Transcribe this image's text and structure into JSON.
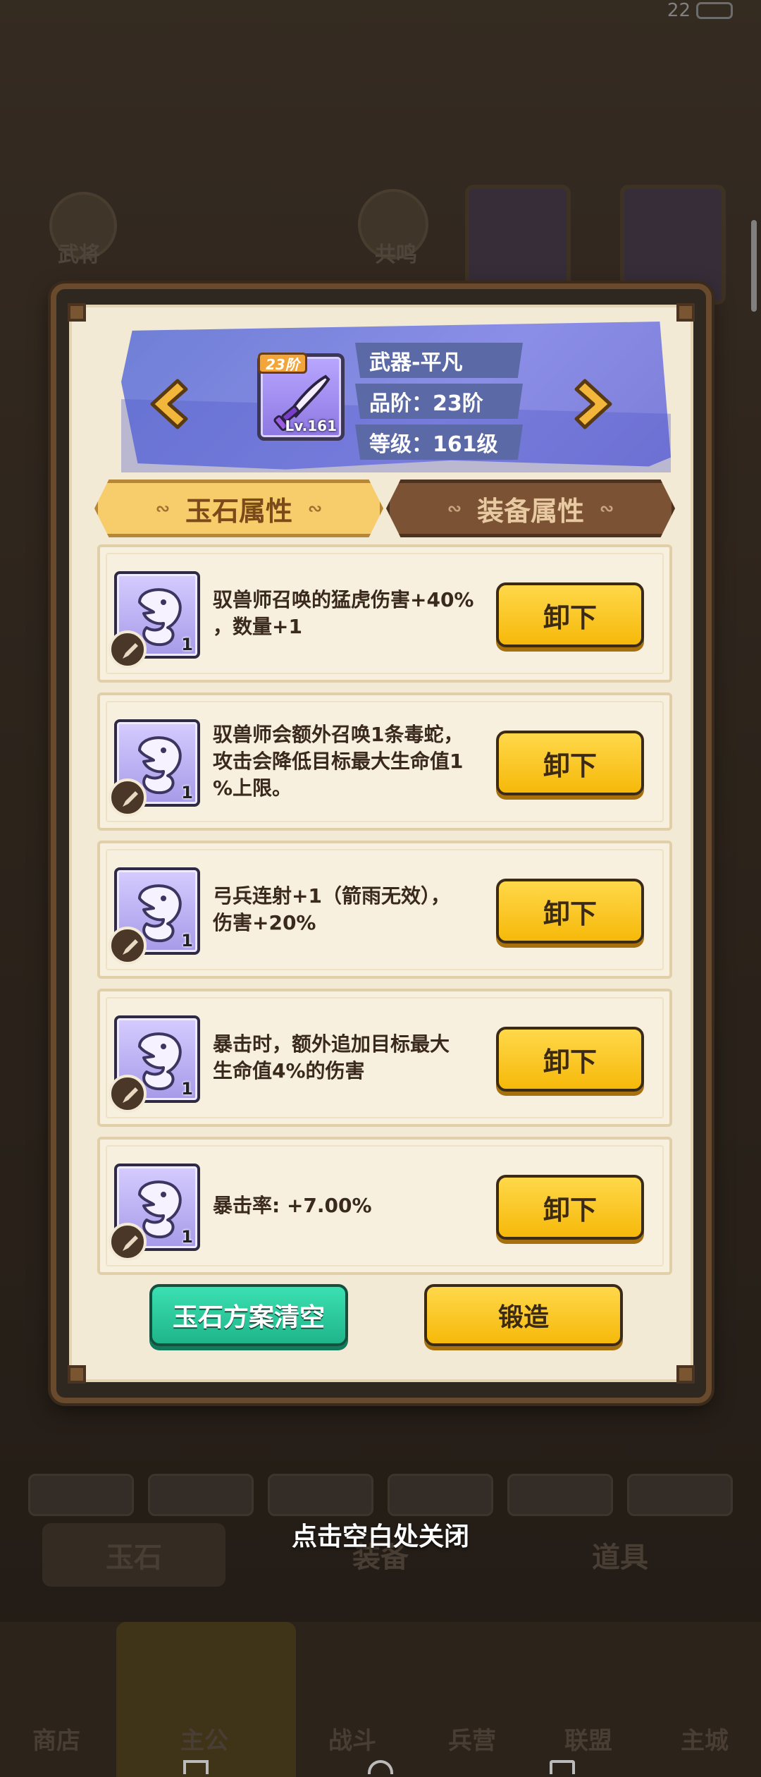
{
  "status": {
    "time": "22"
  },
  "background": {
    "top_labels": [
      "武将",
      "共鸣"
    ],
    "tabs": [
      "玉石",
      "装备",
      "道具"
    ],
    "nav": [
      "商店",
      "主公",
      "战斗",
      "兵营",
      "联盟",
      "主城"
    ]
  },
  "equipment": {
    "grade_badge": "23阶",
    "level_badge": "Lv.161",
    "name": "武器-平凡",
    "grade": "品阶：23阶",
    "level": "等级：161级",
    "icon": "sword-icon"
  },
  "tabs": {
    "jade_attr": "玉石属性",
    "equip_attr": "装备属性"
  },
  "jades": [
    {
      "text": "驭兽师召唤的猛虎伤害+40%\n，数量+1",
      "count": "1",
      "button": "卸下"
    },
    {
      "text": "驭兽师会额外召唤1条毒蛇，\n攻击会降低目标最大生命值1\n%上限。",
      "count": "1",
      "button": "卸下"
    },
    {
      "text": "弓兵连射+1（箭雨无效），\n伤害+20%",
      "count": "1",
      "button": "卸下"
    },
    {
      "text": "暴击时，额外追加目标最大\n生命值4%的伤害",
      "count": "1",
      "button": "卸下"
    },
    {
      "text": "暴击率: +7.00%",
      "count": "1",
      "button": "卸下"
    }
  ],
  "actions": {
    "clear": "玉石方案清空",
    "forge": "锻造"
  },
  "close_hint": "点击空白处关闭",
  "colors": {
    "accent_yellow": "#f6b90a",
    "accent_green": "#1fb58a",
    "banner_purple": "#7c7dd8"
  }
}
